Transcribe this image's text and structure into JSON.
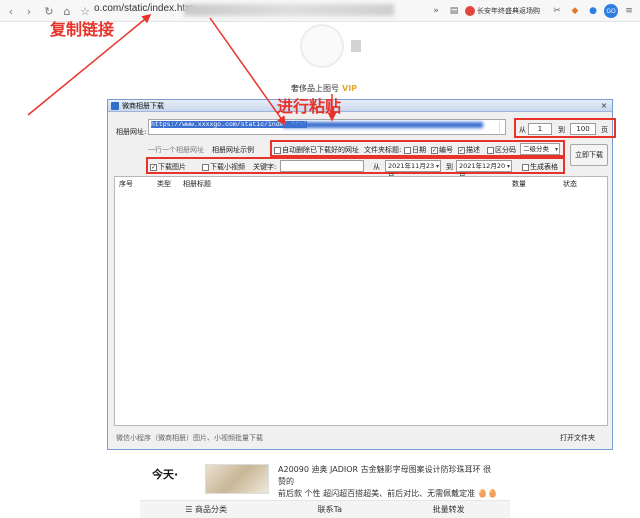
{
  "browser": {
    "url": "o.com/static/index.htm",
    "promo": "长安年终盛典返场购",
    "promo_icon": "gift-icon",
    "ext_badge": "GO"
  },
  "annotations": {
    "copy_link": "复制链接",
    "paste": "进行粘贴"
  },
  "shop": {
    "name": "奢侈品上图号",
    "vip": "VIP"
  },
  "dialog": {
    "title": "微商相册下载",
    "close": "×",
    "album_url_label": "相册网址:",
    "album_url_value": "https://www.xxxxgo.com/static/index.html",
    "page_from": "从",
    "page_start": "1",
    "page_to": "到",
    "page_end": "100",
    "page_unit": "页",
    "one_url_per_line": "一行一个相册网址",
    "url_example": "相册网址示例",
    "auto_delete": "自动删除已下载好的网址",
    "folder_label": "文件夹标题:",
    "cb_date": "日期",
    "cb_number": "编号",
    "cb_desc": "描述",
    "cb_code": "区分码",
    "category_select": "二级分类",
    "download_now": "立即下载",
    "download_images": "下载图片",
    "download_videos": "下载小视频",
    "keyword_label": "关键字:",
    "date_from": "从",
    "date_start": "2021年11月23日",
    "date_to": "到",
    "date_end": "2021年12月20日",
    "gen_sheet": "生成表格",
    "columns": [
      "序号",
      "类型",
      "相册标题",
      "数量",
      "状态"
    ],
    "footer_left": "微信小程序（微商相册）图片、小视频批量下载",
    "open_folder": "打开文件夹"
  },
  "feed": {
    "today": "今天·",
    "product_line1": "A20090 迪奥 JADIOR 古金魅影字母图案设计防珍珠耳环 很赞的",
    "product_line2": "前后款 个性 超闪超百搭超美、前后对比、无需佩戴定准 🥚🥚黄…"
  },
  "bottom_nav": {
    "categories": "商品分类",
    "contact": "联系Ta",
    "batch_forward": "批量转发"
  }
}
